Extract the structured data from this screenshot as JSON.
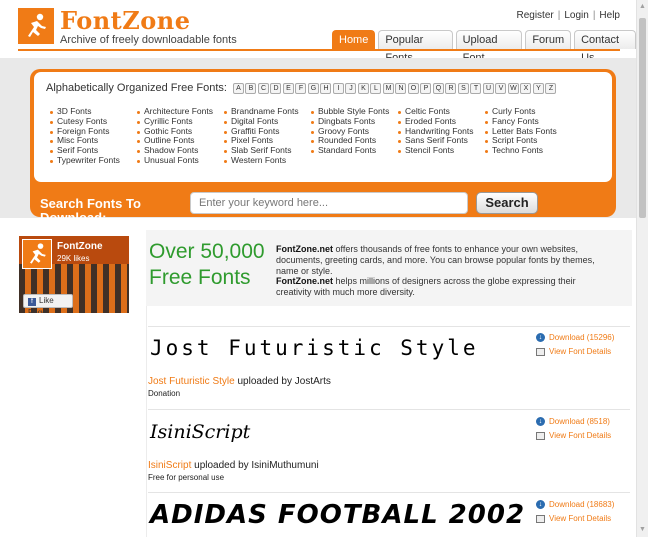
{
  "header": {
    "site_title": "FontZone",
    "tagline": "Archive of freely downloadable fonts",
    "top_links": [
      "Register",
      "Login",
      "Help"
    ],
    "nav_tabs": [
      {
        "label": "Home",
        "active": true
      },
      {
        "label": "Popular Fonts",
        "active": false
      },
      {
        "label": "Upload Font",
        "active": false
      },
      {
        "label": "Forum",
        "active": false
      },
      {
        "label": "Contact Us",
        "active": false
      }
    ]
  },
  "browse": {
    "alpha_label": "Alphabetically Organized Free Fonts:",
    "letters": [
      "A",
      "B",
      "C",
      "D",
      "E",
      "F",
      "G",
      "H",
      "I",
      "J",
      "K",
      "L",
      "M",
      "N",
      "O",
      "P",
      "Q",
      "R",
      "S",
      "T",
      "U",
      "V",
      "W",
      "X",
      "Y",
      "Z"
    ],
    "categories": [
      [
        "3D Fonts",
        "Cutesy Fonts",
        "Foreign Fonts",
        "Misc Fonts",
        "Serif Fonts",
        "Typewriter Fonts"
      ],
      [
        "Architecture Fonts",
        "Cyrillic Fonts",
        "Gothic Fonts",
        "Outline Fonts",
        "Shadow Fonts",
        "Unusual Fonts"
      ],
      [
        "Brandname Fonts",
        "Digital Fonts",
        "Graffiti Fonts",
        "Pixel Fonts",
        "Slab Serif Fonts",
        "Western Fonts"
      ],
      [
        "Bubble Style Fonts",
        "Dingbats Fonts",
        "Groovy Fonts",
        "Rounded Fonts",
        "Standard Fonts"
      ],
      [
        "Celtic Fonts",
        "Eroded Fonts",
        "Handwriting Fonts",
        "Sans Serif Fonts",
        "Stencil Fonts"
      ],
      [
        "Curly Fonts",
        "Fancy Fonts",
        "Letter Bats Fonts",
        "Script Fonts",
        "Techno Fonts"
      ]
    ]
  },
  "search": {
    "label": "Search Fonts To Download:",
    "placeholder": "Enter your keyword here...",
    "button_label": "Search"
  },
  "facebook": {
    "page_name": "FontZone",
    "likes": "29K likes",
    "like_button": "Like Page"
  },
  "promo": {
    "headline_1": "Over 50,000",
    "headline_2": "Free Fonts",
    "para1_brand": "FontZone.net",
    "para1_text": " offers thousands of free fonts to enhance your own websites, documents, greeting cards, and more. You can browse popular fonts by themes, name or style.",
    "para2_brand": "FontZone.net",
    "para2_text": " helps millions of designers across the globe expressing their creativity with much more diversity."
  },
  "fonts": [
    {
      "preview": "Jost Futuristic Style",
      "name": "Jost Futuristic Style",
      "uploader_text": " uploaded by JostArts",
      "license": "Donation",
      "download": "Download (15296)",
      "details": "View Font Details"
    },
    {
      "preview": "IsiniScript",
      "name": "IsiniScript",
      "uploader_text": " uploaded by IsiniMuthumuni",
      "license": "Free for personal use",
      "download": "Download (8518)",
      "details": "View Font Details"
    },
    {
      "preview": "ADIDAS FOOTBALL 2002",
      "download": "Download (18683)",
      "details": "View Font Details"
    }
  ],
  "colors": {
    "accent": "#f07b16",
    "promo_green": "#2f9b2e"
  }
}
